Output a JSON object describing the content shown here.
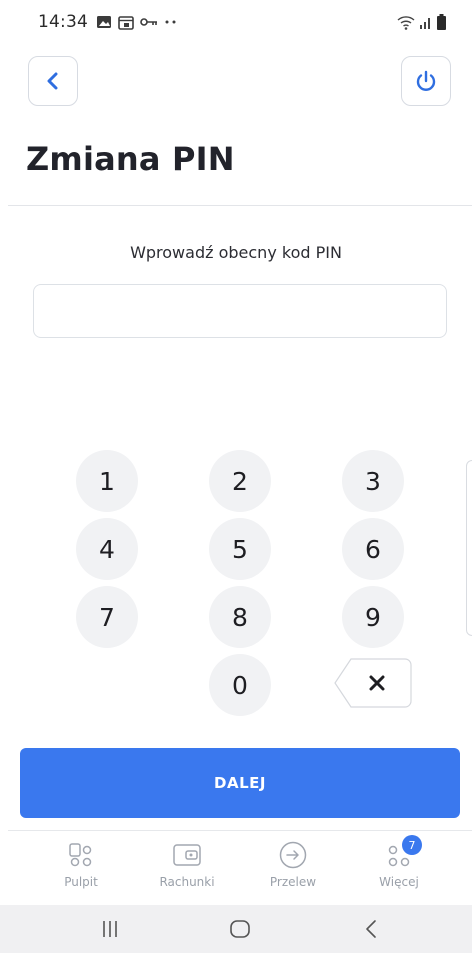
{
  "status_bar": {
    "time": "14:34",
    "left_icons": [
      "image-icon",
      "calendar-icon",
      "key-icon",
      "more-dots-icon"
    ],
    "right_icons": [
      "wifi-icon",
      "signal-icon",
      "battery-icon"
    ]
  },
  "header": {
    "back_icon": "chevron-left-icon",
    "power_icon": "power-icon",
    "title": "Zmiana PIN"
  },
  "pin_entry": {
    "prompt": "Wprowadź obecny kod PIN",
    "value": ""
  },
  "keypad": {
    "keys": [
      "1",
      "2",
      "3",
      "4",
      "5",
      "6",
      "7",
      "8",
      "9",
      "0"
    ],
    "backspace_icon": "backspace-icon"
  },
  "actions": {
    "next_label": "DALEJ"
  },
  "bottom_nav": {
    "items": [
      {
        "label": "Pulpit",
        "icon": "dashboard-icon"
      },
      {
        "label": "Rachunki",
        "icon": "wallet-icon"
      },
      {
        "label": "Przelew",
        "icon": "arrow-circle-icon"
      },
      {
        "label": "Więcej",
        "icon": "more-icon",
        "badge": "7"
      }
    ]
  },
  "colors": {
    "accent": "#3a78ee",
    "key_bg": "#f1f2f4",
    "nav_text": "#9aa0a9"
  }
}
